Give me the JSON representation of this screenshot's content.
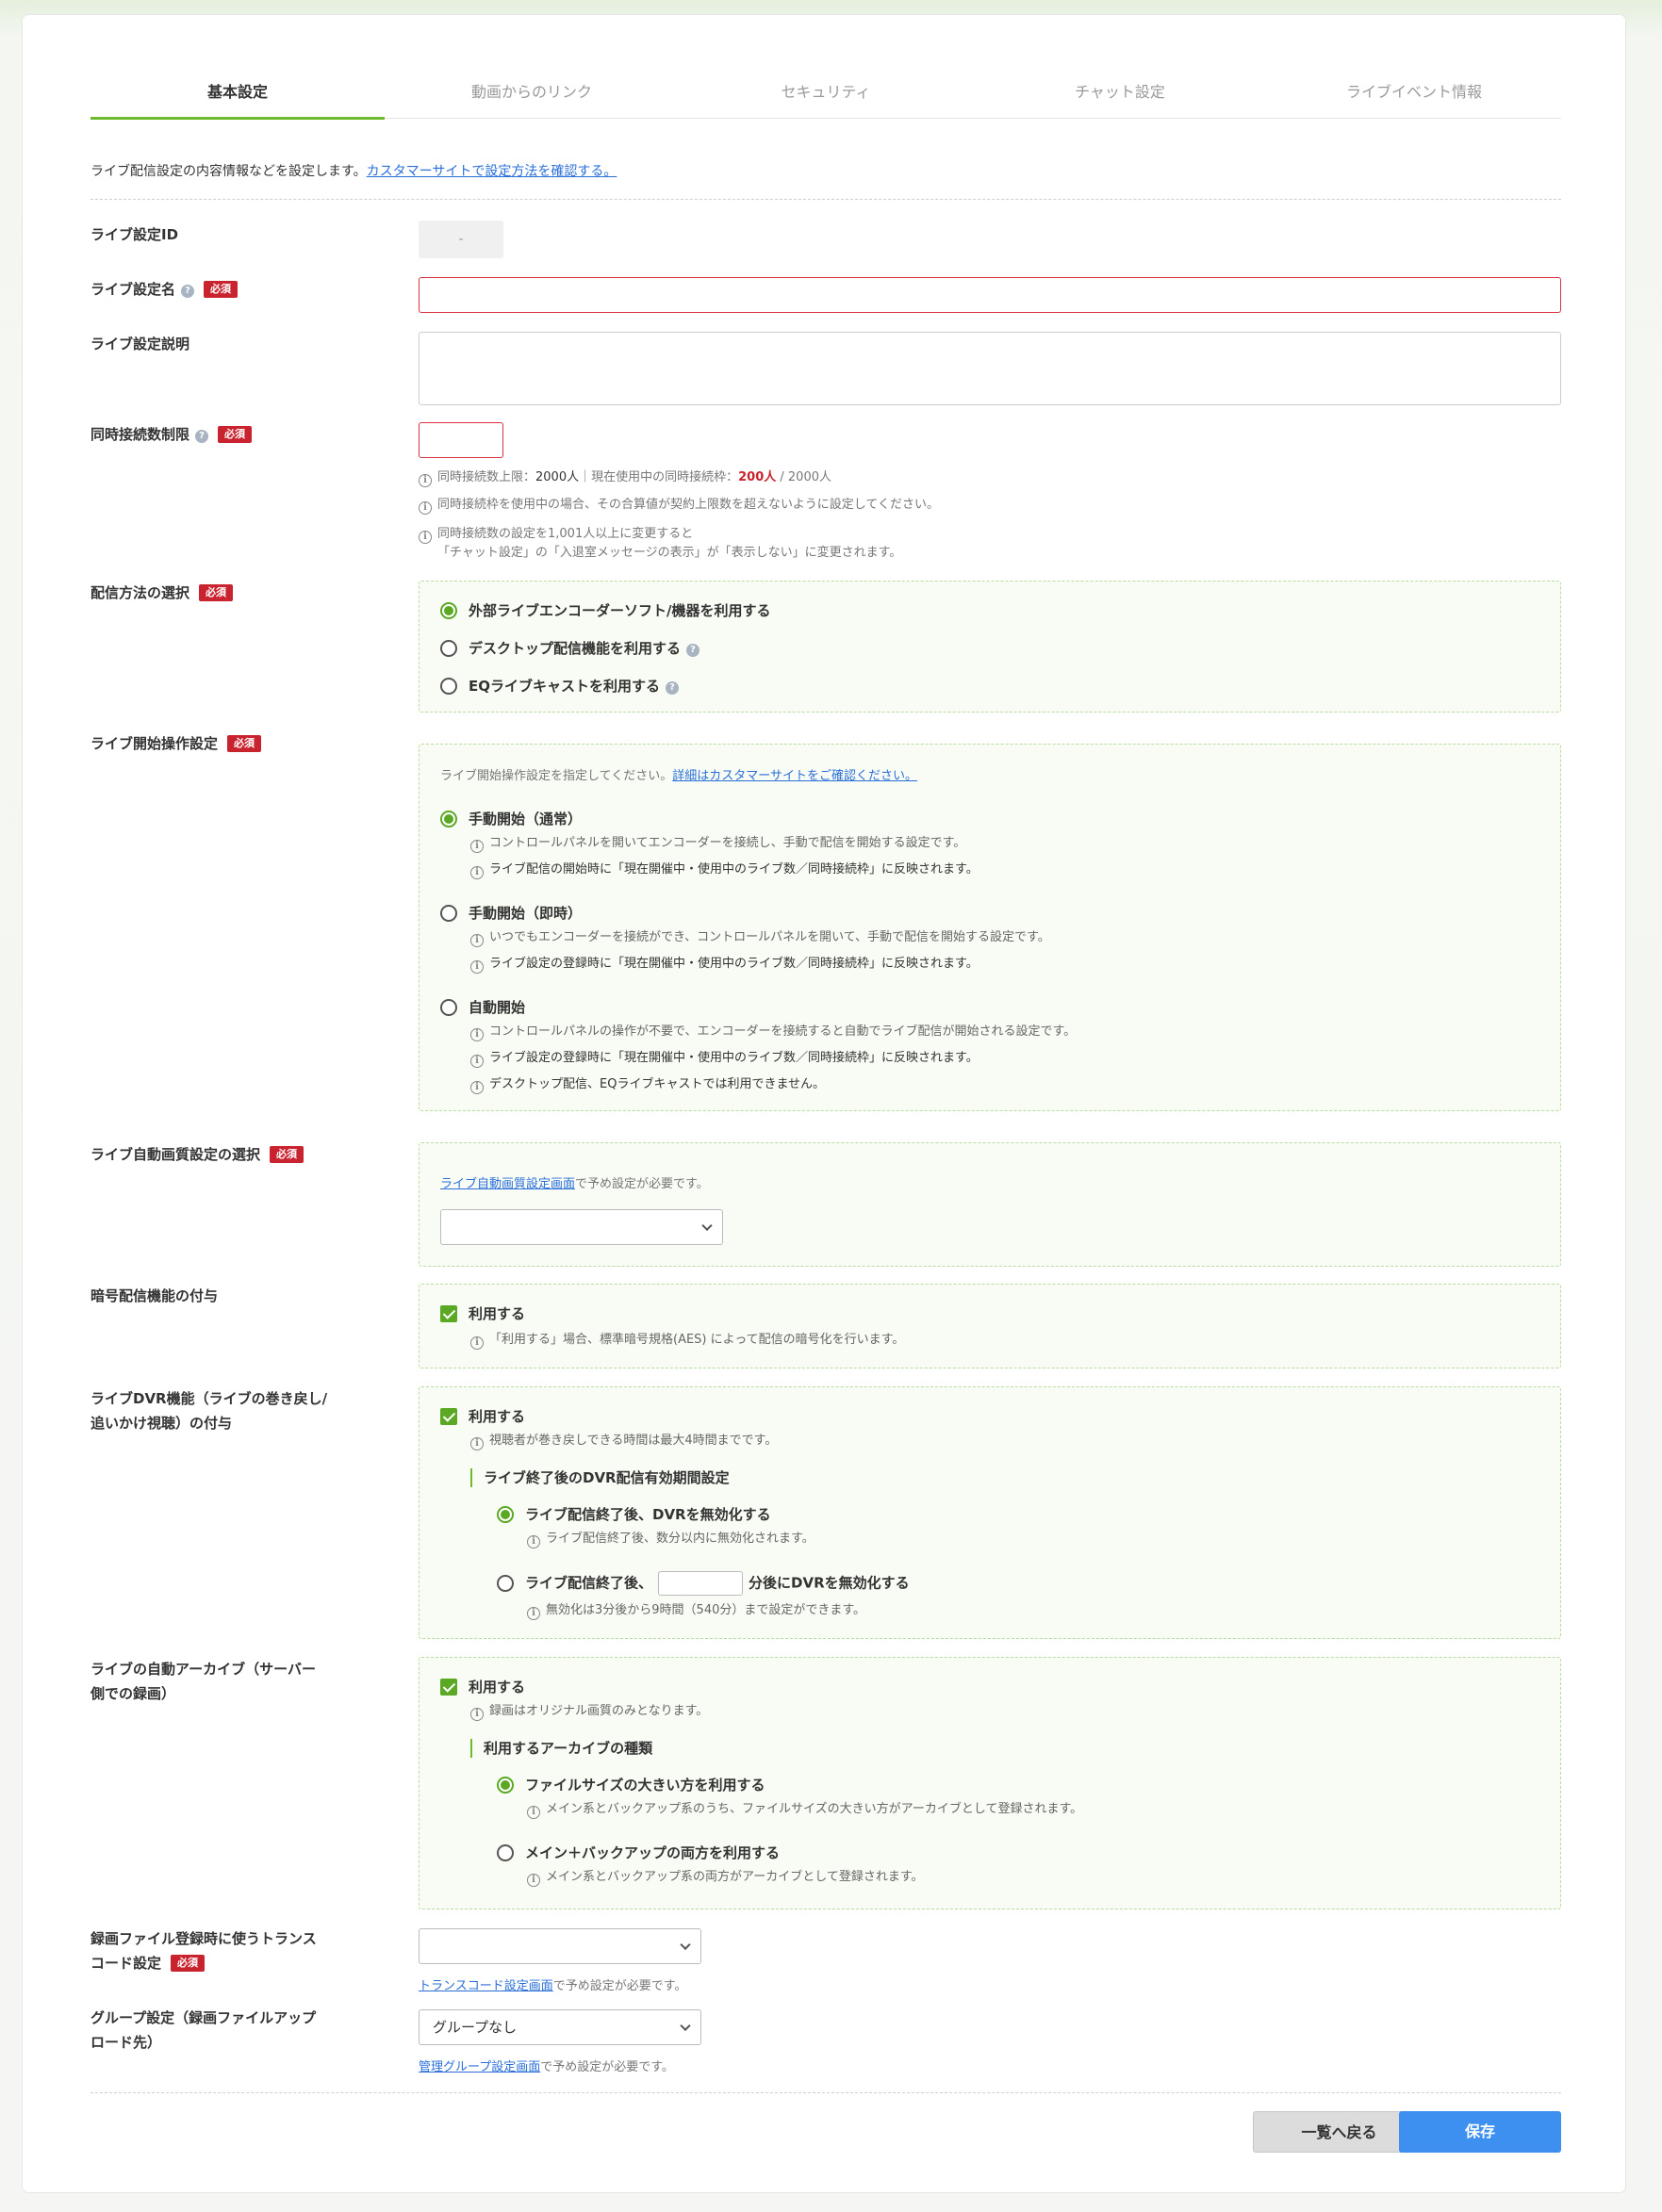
{
  "tabs": [
    "基本設定",
    "動画からのリンク",
    "セキュリティ",
    "チャット設定",
    "ライブイベント情報"
  ],
  "intro": {
    "text": "ライブ配信設定の内容情報などを設定します。",
    "link": "カスタマーサイトで設定方法を確認する。"
  },
  "required_badge": "必須",
  "help_glyph": "?",
  "info_glyph": "i",
  "fields": {
    "live_id": {
      "label": "ライブ設定ID",
      "value": "-"
    },
    "live_name": {
      "label": "ライブ設定名"
    },
    "live_desc": {
      "label": "ライブ設定説明"
    },
    "concurrent": {
      "label": "同時接続数制限",
      "note1_a": "同時接続数上限：",
      "note1_b": "2000人",
      "note1_c": "｜現在使用中の同時接続枠：",
      "note1_d": "200人",
      "note1_e": " / 2000人",
      "note2": "同時接続枠を使用中の場合、その合算値が契約上限数を超えないように設定してください。",
      "note3a": "同時接続数の設定を1,001人以上に変更すると",
      "note3b": "「チャット設定」の「入退室メッセージの表示」が「表示しない」に変更されます。"
    },
    "method": {
      "label": "配信方法の選択",
      "options": [
        "外部ライブエンコーダーソフト/機器を利用する",
        "デスクトップ配信機能を利用する",
        "EQライブキャストを利用する"
      ]
    },
    "start": {
      "label": "ライブ開始操作設定",
      "lead": "ライブ開始操作設定を指定してください。",
      "lead_link": "詳細はカスタマーサイトをご確認ください。",
      "opt1": "手動開始（通常）",
      "opt1_n1": "コントロールパネルを開いてエンコーダーを接続し、手動で配信を開始する設定です。",
      "opt1_n2": "ライブ配信の開始時に「現在開催中・使用中のライブ数／同時接続枠」に反映されます。",
      "opt2": "手動開始（即時）",
      "opt2_n1": "いつでもエンコーダーを接続ができ、コントロールパネルを開いて、手動で配信を開始する設定です。",
      "opt2_n2": "ライブ設定の登録時に「現在開催中・使用中のライブ数／同時接続枠」に反映されます。",
      "opt3": "自動開始",
      "opt3_n1": "コントロールパネルの操作が不要で、エンコーダーを接続すると自動でライブ配信が開始される設定です。",
      "opt3_n2": "ライブ設定の登録時に「現在開催中・使用中のライブ数／同時接続枠」に反映されます。",
      "opt3_n3": "デスクトップ配信、EQライブキャストでは利用できません。"
    },
    "quality": {
      "label": "ライブ自動画質設定の選択",
      "link": "ライブ自動画質設定画面",
      "lead": "で予め設定が必要です。",
      "value": ""
    },
    "encrypt": {
      "label": "暗号配信機能の付与",
      "check": "利用する",
      "note": "「利用する」場合、標準暗号規格(AES) によって配信の暗号化を行います。"
    },
    "dvr": {
      "label1": "ライブDVR機能（ライブの巻き戻し/",
      "label2": "追いかけ視聴）の付与",
      "check": "利用する",
      "note": "視聴者が巻き戻しできる時間は最大4時間までです。",
      "subhead": "ライブ終了後のDVR配信有効期間設定",
      "opt1": "ライブ配信終了後、DVRを無効化する",
      "opt1_n": "ライブ配信終了後、数分以内に無効化されます。",
      "opt2_a": "ライブ配信終了後、",
      "opt2_b": "分後にDVRを無効化する",
      "opt2_n": "無効化は3分後から9時間（540分）まで設定ができます。"
    },
    "archive": {
      "label1": "ライブの自動アーカイブ（サーバー",
      "label2": "側での録画）",
      "check": "利用する",
      "note": "録画はオリジナル画質のみとなります。",
      "subhead": "利用するアーカイブの種類",
      "opt1": "ファイルサイズの大きい方を利用する",
      "opt1_n": "メイン系とバックアップ系のうち、ファイルサイズの大きい方がアーカイブとして登録されます。",
      "opt2": "メイン＋バックアップの両方を利用する",
      "opt2_n": "メイン系とバックアップ系の両方がアーカイブとして登録されます。"
    },
    "transcode": {
      "label1": "録画ファイル登録時に使うトランス",
      "label2": "コード設定",
      "value": "",
      "link": "トランスコード設定画面",
      "lead": "で予め設定が必要です。"
    },
    "group": {
      "label1": "グループ設定（録画ファイルアップ",
      "label2": "ロード先）",
      "value": "グループなし",
      "link": "管理グループ設定画面",
      "lead": "で予め設定が必要です。"
    }
  },
  "buttons": {
    "back": "一覧へ戻る",
    "save": "保存"
  }
}
